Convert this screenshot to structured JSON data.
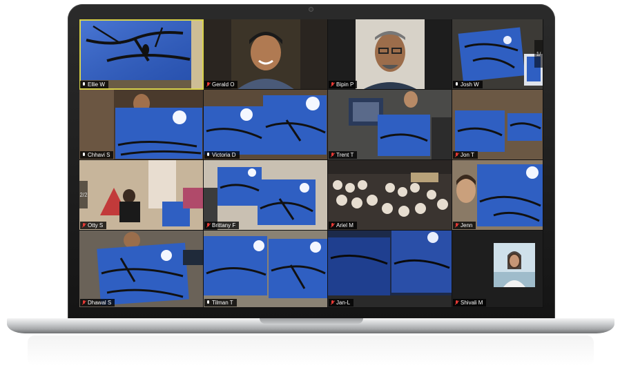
{
  "window": {
    "app": "Zoom gallery view"
  },
  "colors": {
    "active_speaker_border": "#d8d24a",
    "muted_icon": "#e53935",
    "painting_blue": "#2f5fc2"
  },
  "participants": [
    {
      "name": "Ellie W",
      "muted": false,
      "active": true,
      "scene": "painting-closeup"
    },
    {
      "name": "Gerald O",
      "muted": true,
      "scene": "smiling-man-webcam"
    },
    {
      "name": "Bipin P",
      "muted": true,
      "scene": "man-with-glasses-webcam"
    },
    {
      "name": "Josh W",
      "muted": false,
      "scene": "holding-painting"
    },
    {
      "name": "Chhavi S",
      "muted": false,
      "scene": "holding-painting"
    },
    {
      "name": "Victoria D",
      "muted": false,
      "scene": "two-paintings"
    },
    {
      "name": "Trent T",
      "muted": true,
      "scene": "man-holding-painting-tv"
    },
    {
      "name": "Jon T",
      "muted": true,
      "scene": "two-paintings"
    },
    {
      "name": "Otty S",
      "muted": true,
      "scene": "room-with-child"
    },
    {
      "name": "Brittany F",
      "muted": true,
      "scene": "two-paintings"
    },
    {
      "name": "Ariel M",
      "muted": true,
      "scene": "pastry-display"
    },
    {
      "name": "Jenn",
      "muted": true,
      "scene": "woman-with-painting"
    },
    {
      "name": "Dhawal S",
      "muted": true,
      "scene": "holding-painting"
    },
    {
      "name": "Tilman T",
      "muted": false,
      "scene": "two-paintings"
    },
    {
      "name": "Jan-L",
      "muted": true,
      "scene": "two-paintings-dark"
    },
    {
      "name": "Shivali M",
      "muted": true,
      "scene": "woman-beach-thumbnail"
    }
  ],
  "pager": {
    "left_label": "2/2",
    "right_label": "1/"
  }
}
